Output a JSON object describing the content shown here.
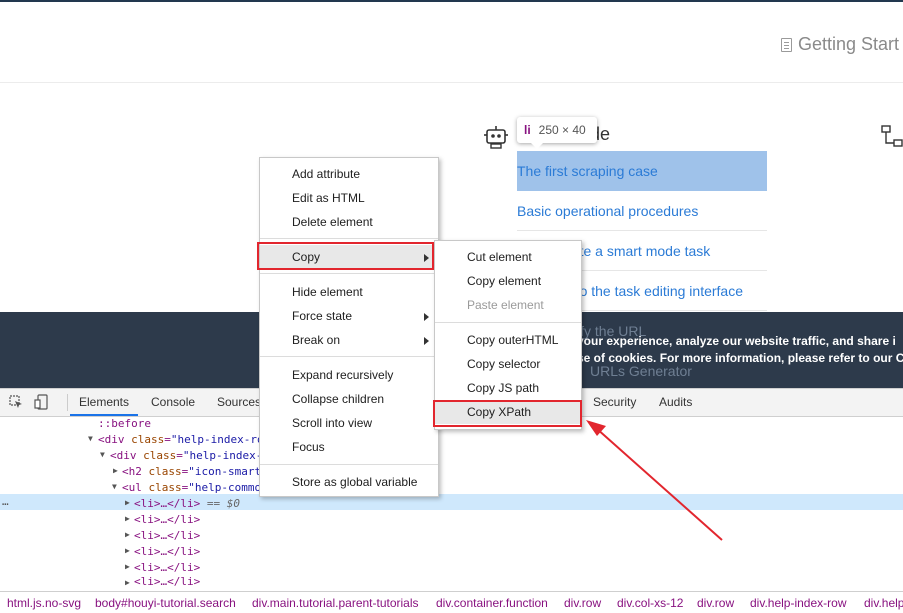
{
  "page": {
    "header_title": "Getting Start",
    "section_title": "de",
    "links": [
      "The first scraping case",
      "Basic operational procedures",
      "eate a smart mode task",
      "n to the task editing interface"
    ],
    "ghost_links": [
      "ify the URL",
      "URLs Generator"
    ],
    "tooltip": {
      "tag": "li",
      "dimensions": "250 × 40"
    },
    "cookie_banner": {
      "line1": "your experience, analyze our website traffic, and share i",
      "line2": "se of cookies. For more information, please refer to our C"
    }
  },
  "devtools": {
    "tabs": [
      "Elements",
      "Console",
      "Sources",
      "Security",
      "Audits"
    ],
    "dom_lines": [
      {
        "text": "::before"
      },
      {
        "tag": "div",
        "attr": "class",
        "val": "\"help-index-ro"
      },
      {
        "tag": "div",
        "attr": "class",
        "val": "\"help-index-"
      },
      {
        "tag": "h2",
        "attr": "class",
        "val": "\"icon-smart"
      },
      {
        "tag": "ul",
        "attr": "class",
        "val": "\"help-commo"
      },
      {
        "text": "<li>…</li>",
        "suffix": " == $0"
      },
      {
        "text": "<li>…</li>"
      },
      {
        "text": "<li>…</li>"
      },
      {
        "text": "<li>…</li>"
      },
      {
        "text": "<li>…</li>"
      },
      {
        "text": "<li>…</li>"
      }
    ],
    "ellipsis": "…",
    "breadcrumbs": [
      "html.js.no-svg",
      "body#houyi-tutorial.search",
      "div.main.tutorial.parent-tutorials",
      "div.container.function",
      "div.row",
      "div.col-xs-12",
      "div.row",
      "div.help-index-row",
      "div.help"
    ]
  },
  "context_menu": {
    "items": [
      {
        "label": "Add attribute"
      },
      {
        "label": "Edit as HTML"
      },
      {
        "label": "Delete element"
      },
      {
        "label": "Copy",
        "submenu": true
      },
      {
        "label": "Hide element"
      },
      {
        "label": "Force state",
        "submenu": true
      },
      {
        "label": "Break on",
        "submenu": true
      },
      {
        "label": "Expand recursively"
      },
      {
        "label": "Collapse children"
      },
      {
        "label": "Scroll into view"
      },
      {
        "label": "Focus"
      },
      {
        "label": "Store as global variable"
      }
    ]
  },
  "copy_submenu": {
    "items": [
      {
        "label": "Cut element"
      },
      {
        "label": "Copy element"
      },
      {
        "label": "Paste element",
        "disabled": true
      },
      {
        "label": "Copy outerHTML"
      },
      {
        "label": "Copy selector"
      },
      {
        "label": "Copy JS path"
      },
      {
        "label": "Copy XPath"
      }
    ]
  },
  "colors": {
    "highlight": "#9fc2ea",
    "annotation": "#e2262e",
    "link": "#2b7bd6",
    "banner": "#2d3a4b"
  },
  "icons": [
    "document-icon",
    "robot-icon",
    "flowchart-icon",
    "inspect-icon",
    "device-toggle-icon",
    "expand-triangle-icon",
    "submenu-arrow-icon"
  ]
}
